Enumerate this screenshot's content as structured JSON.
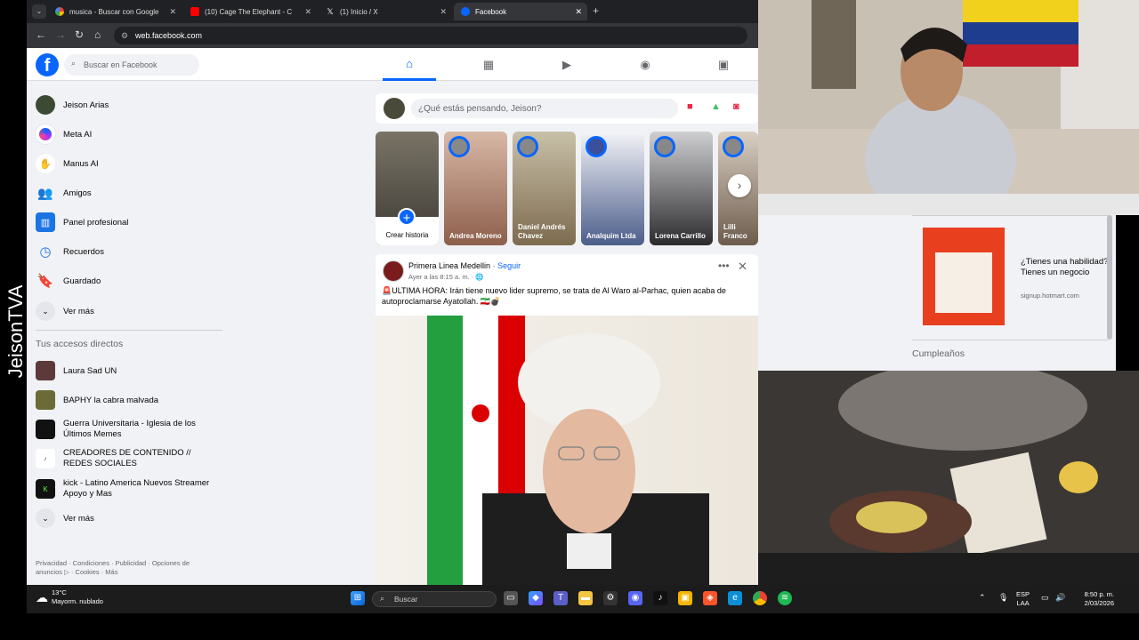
{
  "watermark": "JeisonTVA",
  "browser": {
    "tabs": [
      {
        "title": "musica - Buscar con Google",
        "icon": "google-icon"
      },
      {
        "title": "(10) Cage The Elephant - C",
        "icon": "youtube-icon"
      },
      {
        "title": "(1) Inicio / X",
        "icon": "x-icon"
      },
      {
        "title": "Facebook",
        "icon": "facebook-icon"
      }
    ],
    "url": "web.facebook.com"
  },
  "facebook": {
    "search_placeholder": "Buscar en Facebook",
    "sidebar": [
      {
        "label": "Jeison Arias",
        "icon": "avatar"
      },
      {
        "label": "Meta AI",
        "icon": "meta-ai-icon"
      },
      {
        "label": "Manus AI",
        "icon": "manus-icon"
      },
      {
        "label": "Amigos",
        "icon": "friends-icon"
      },
      {
        "label": "Panel profesional",
        "icon": "dashboard-icon"
      },
      {
        "label": "Recuerdos",
        "icon": "memories-icon"
      },
      {
        "label": "Guardado",
        "icon": "bookmark-icon"
      },
      {
        "label": "Ver más",
        "icon": "chevron-down-icon"
      }
    ],
    "shortcuts_title": "Tus accesos directos",
    "shortcuts": [
      {
        "label": "Laura Sad UN"
      },
      {
        "label": "BAPHY la cabra malvada"
      },
      {
        "label": "Guerra Universitaria - Iglesia de los Últimos Memes"
      },
      {
        "label": "CREADORES DE CONTENIDO // REDES SOCIALES"
      },
      {
        "label": "kick - Latino America Nuevos Streamer Apoyo y Mas"
      },
      {
        "label": "Ver más"
      }
    ],
    "footer": "Privacidad · Condiciones · Publicidad · Opciones de anuncios ▷ · Cookies · Más",
    "composer_placeholder": "¿Qué estás pensando, Jeison?",
    "stories": {
      "create_label": "Crear historia",
      "items": [
        {
          "name": "Andrea Moreno",
          "color": "#c79c8a"
        },
        {
          "name": "Daniel Andrés Chavez",
          "color": "#b8a98e"
        },
        {
          "name": "Analquim Ltda",
          "color": "#5b6fa6"
        },
        {
          "name": "Lorena Carrillo",
          "color": "#8d8e93"
        },
        {
          "name": "Lilli Franco",
          "color": "#a89c90"
        }
      ]
    },
    "post": {
      "author": "Primera Linea Medellin",
      "follow": "Seguir",
      "time": "Ayer a las 8:15 a. m. · 🌐",
      "text": "🚨ULTIMA HORA: Irán tiene nuevo lider supremo, se trata de Al Waro al-Parhac, quien acaba de autoproclamarse Ayatollah. 🇮🇷💣"
    },
    "ad": {
      "title": "¿Tienes una habilidad? Tienes un negocio",
      "url": "signup.hotmart.com"
    },
    "birthdays": "Cumpleaños"
  },
  "taskbar": {
    "temp": "13°C",
    "weather": "Mayorm. nublado",
    "search": "Buscar",
    "lang": "ESP",
    "lang2": "LAA",
    "time": "8:50 p. m.",
    "date": "2/03/2026"
  },
  "colors": {
    "fb_blue": "#0866ff",
    "page_bg": "#f0f2f5"
  }
}
